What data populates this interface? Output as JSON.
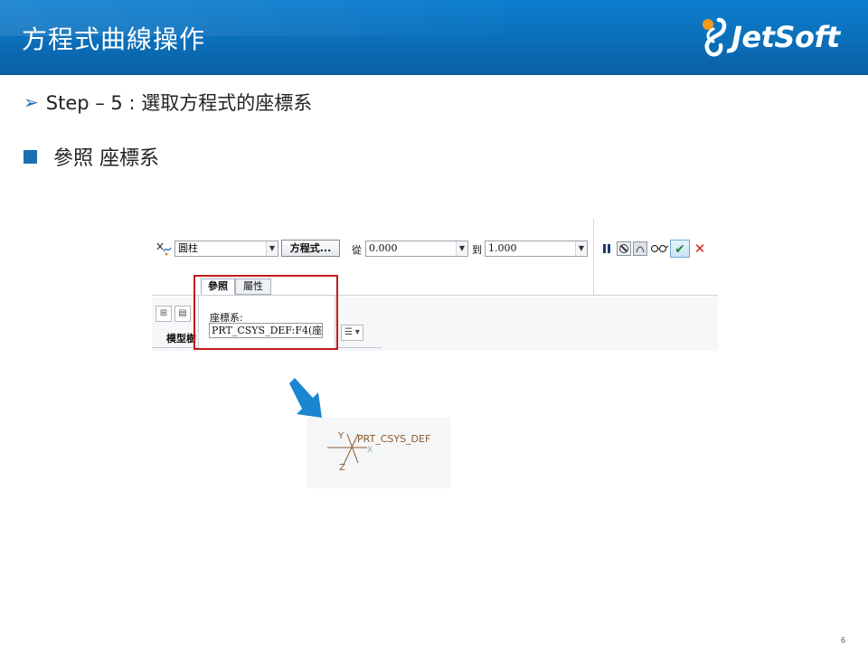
{
  "slide": {
    "title": "方程式曲線操作",
    "logo_text": "JetSoft",
    "bullet1_arrow": "➢",
    "bullet1": "Step – 5 : 選取方程式的座標系",
    "bullet2": "參照 座標系",
    "page_number": "6"
  },
  "toolbar": {
    "curve_type_value": "圓柱",
    "equation_button": "方程式...",
    "from_label": "從",
    "from_value": "0.000",
    "to_label": "到",
    "to_value": "1.000",
    "dropdown_glyph": "▼"
  },
  "tabs": [
    {
      "label": "參照"
    },
    {
      "label": "屬性"
    }
  ],
  "reference_panel": {
    "field_label": "座標系:",
    "field_value": "PRT_CSYS_DEF:F4(座標"
  },
  "model_tree": {
    "header": "模型樹"
  },
  "csys_preview": {
    "label": "PRT_CSYS_DEF",
    "axis_y": "Y",
    "axis_x": "X",
    "axis_z": "Z"
  },
  "colors": {
    "header_blue": "#0b6fb9",
    "accent_blue": "#1d6fb4",
    "highlight_red": "#c51a1a",
    "arrow_blue": "#1a86d1"
  }
}
